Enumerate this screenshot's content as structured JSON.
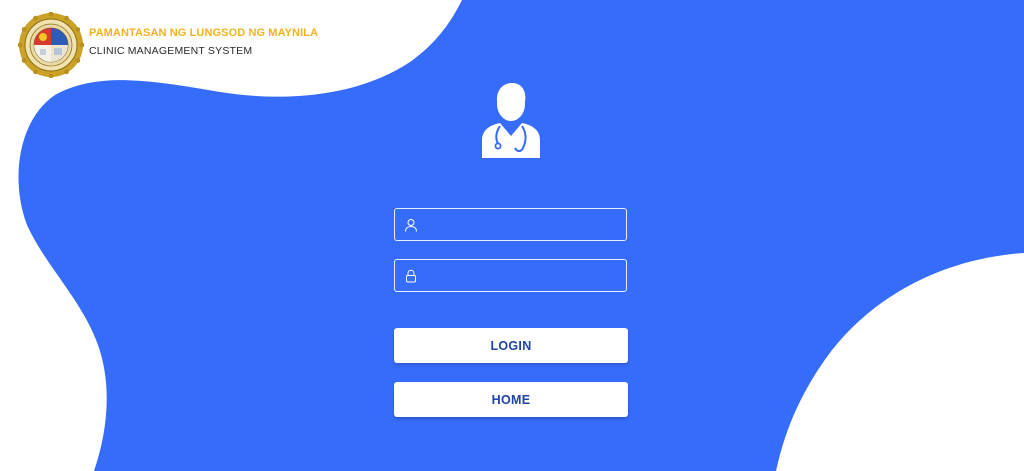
{
  "header": {
    "university_name": "PAMANTASAN NG LUNGSOD NG MAYNILA",
    "system_name": "CLINIC MANAGEMENT SYSTEM",
    "logo_icon": "plm-seal-logo"
  },
  "hero": {
    "icon": "doctor-icon"
  },
  "login_form": {
    "username": {
      "icon": "user-icon",
      "value": "",
      "placeholder": ""
    },
    "password": {
      "icon": "lock-icon",
      "value": "",
      "placeholder": ""
    },
    "login_label": "LOGIN",
    "home_label": "HOME"
  },
  "colors": {
    "background_blue": "#366CFA",
    "page_white": "#FFFFFF",
    "title_gold": "#F3B11E",
    "button_text": "#1F44A6",
    "seal_gold": "#C9A227"
  }
}
